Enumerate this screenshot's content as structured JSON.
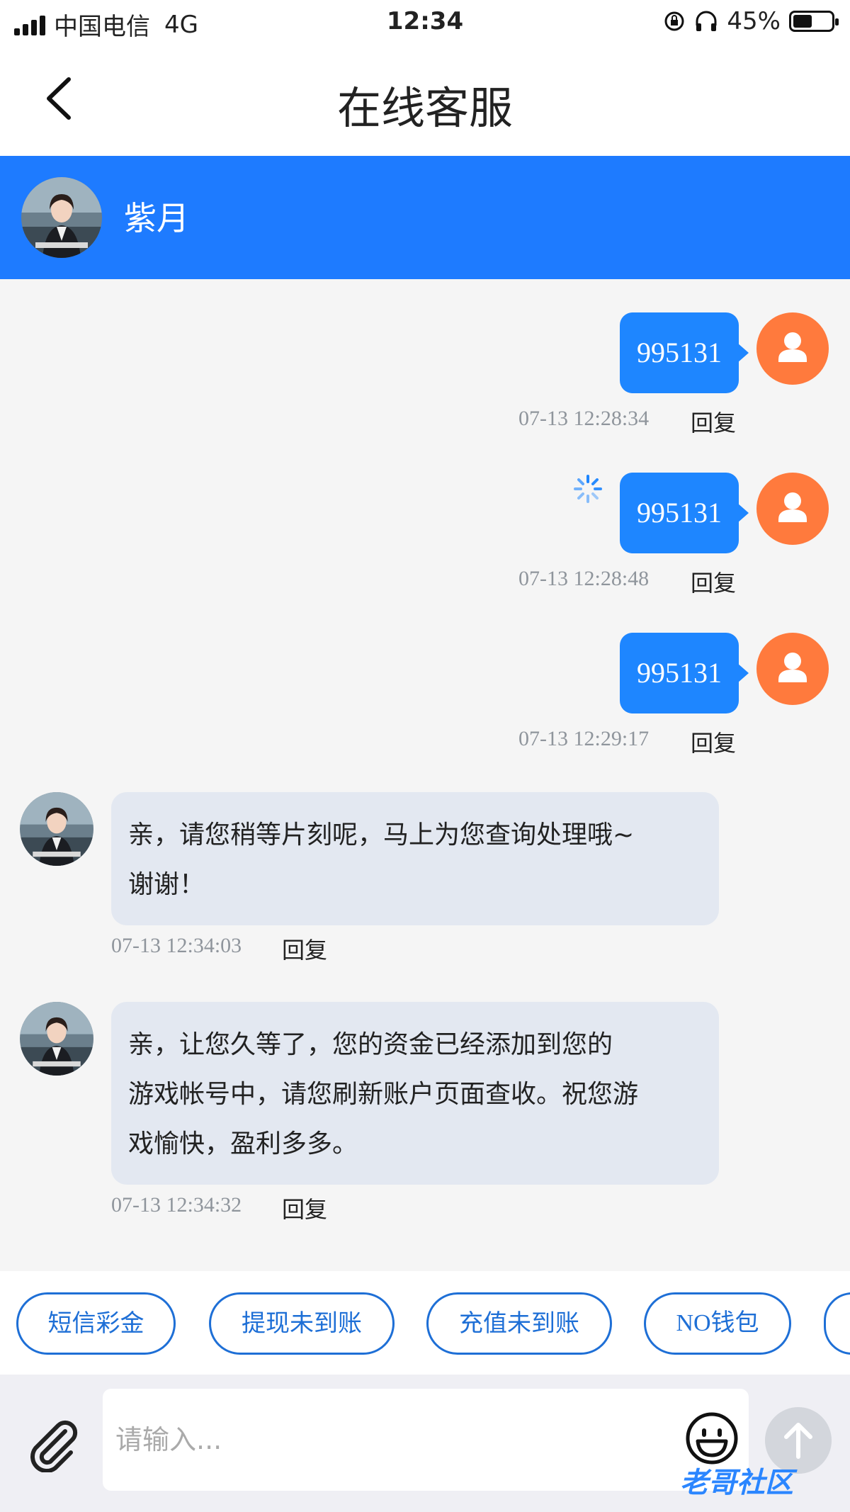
{
  "status_bar": {
    "carrier": "中国电信",
    "network": "4G",
    "time": "12:34",
    "battery": "45%"
  },
  "nav": {
    "title": "在线客服",
    "back_icon": "chevron-left-icon"
  },
  "agent": {
    "name": "紫月"
  },
  "messages": [
    {
      "from": "user",
      "text": "995131",
      "time": "07-13 12:28:34",
      "reply": "回复",
      "sending": false
    },
    {
      "from": "user",
      "text": "995131",
      "time": "07-13 12:28:48",
      "reply": "回复",
      "sending": true
    },
    {
      "from": "user",
      "text": "995131",
      "time": "07-13 12:29:17",
      "reply": "回复",
      "sending": false
    },
    {
      "from": "agent",
      "line1": "亲，请您稍等片刻呢，马上为您查询处理哦~",
      "line2": "谢谢！",
      "time": "07-13 12:34:03",
      "reply": "回复"
    },
    {
      "from": "agent",
      "line1": " 亲，让您久等了，您的资金已经添加到您的",
      "line2": "游戏帐号中，请您刷新账户页面查收。祝您游",
      "line3": "戏愉快，盈利多多。",
      "time": "07-13 12:34:32",
      "reply": "回复"
    }
  ],
  "quick_replies": [
    "短信彩金",
    "提现未到账",
    "充值未到账",
    "NO钱包"
  ],
  "input": {
    "placeholder": "请输入..."
  },
  "watermark": "老哥社区",
  "colors": {
    "brand_blue": "#1e7bff",
    "user_avatar": "#ff7a3d",
    "agent_bubble": "#e3e8f1",
    "chip_border": "#1e6fd6"
  }
}
